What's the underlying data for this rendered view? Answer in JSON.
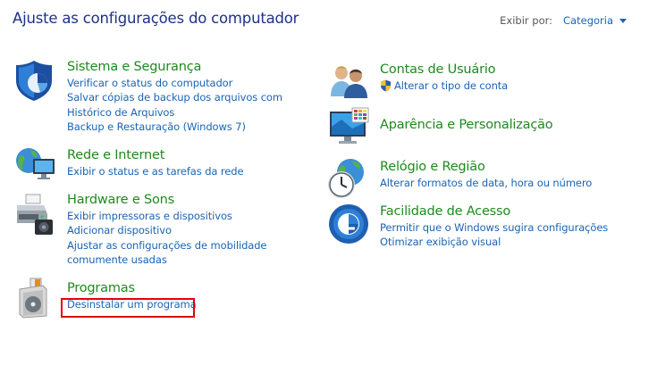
{
  "page_title": "Ajuste as configurações do computador",
  "view_by": {
    "label": "Exibir por:",
    "value": "Categoria"
  },
  "categories": {
    "sistema": {
      "title": "Sistema e Segurança",
      "links": [
        "Verificar o status do computador",
        "Salvar cópias de backup dos arquivos com Histórico de Arquivos",
        "Backup e Restauração (Windows 7)"
      ]
    },
    "rede": {
      "title": "Rede e Internet",
      "links": [
        "Exibir o status e as tarefas da rede"
      ]
    },
    "hardware": {
      "title": "Hardware e Sons",
      "links": [
        "Exibir impressoras e dispositivos",
        "Adicionar dispositivo",
        "Ajustar as configurações de mobilidade comumente usadas"
      ]
    },
    "programas": {
      "title": "Programas",
      "links": [
        "Desinstalar um programa"
      ]
    },
    "contas": {
      "title": "Contas de Usuário",
      "links": [
        "Alterar o tipo de conta"
      ]
    },
    "aparencia": {
      "title": "Aparência e Personalização",
      "links": []
    },
    "relogio": {
      "title": "Relógio e Região",
      "links": [
        "Alterar formatos de data, hora ou número"
      ]
    },
    "facilidade": {
      "title": "Facilidade de Acesso",
      "links": [
        "Permitir que o Windows sugira configurações",
        "Otimizar exibição visual"
      ]
    }
  },
  "icons": {
    "sistema": "shield-icon",
    "rede": "network-globe-icon",
    "hardware": "printer-icon",
    "programas": "programs-disc-icon",
    "contas": "user-accounts-icon",
    "aparencia": "monitor-appearance-icon",
    "relogio": "clock-globe-icon",
    "facilidade": "ease-of-access-icon",
    "uac": "uac-shield-icon"
  },
  "colors": {
    "title": "#1e3287",
    "category_title": "#1e8a1e",
    "link": "#1a64b4",
    "highlight": "#e3000f"
  }
}
